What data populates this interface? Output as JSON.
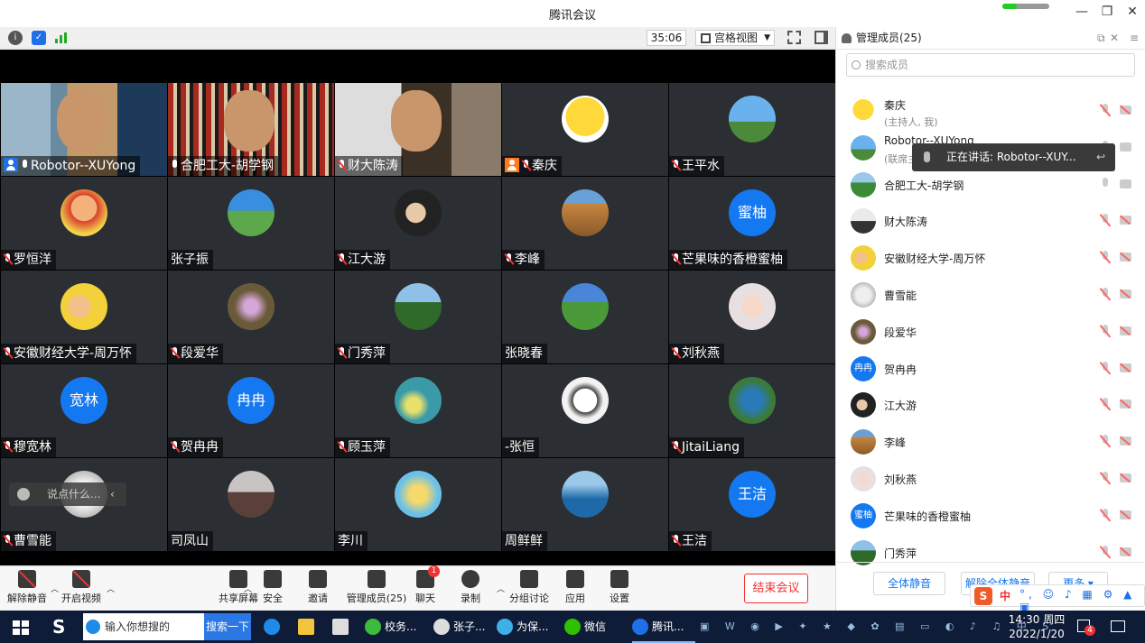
{
  "window": {
    "title": "腾讯会议"
  },
  "toolbar": {
    "timer": "35:06",
    "view_label": "宫格视图"
  },
  "tiles": [
    {
      "name": "Robotor--XUYong",
      "mic": "on",
      "badge": "blue",
      "video": "room"
    },
    {
      "name": "合肥工大-胡学钢",
      "mic": "on",
      "video": "curtain"
    },
    {
      "name": "财大陈涛",
      "mic": "off",
      "video": "light"
    },
    {
      "name": "秦庆",
      "mic": "off",
      "badge": "orange",
      "avatar": "duck"
    },
    {
      "name": "王平水",
      "mic": "off",
      "avatar": "sky"
    },
    {
      "name": "罗恒洋",
      "mic": "off",
      "avatar": "cartoon"
    },
    {
      "name": "张子振",
      "avatar": "field"
    },
    {
      "name": "江大游",
      "mic": "off",
      "avatar": "child"
    },
    {
      "name": "李峰",
      "mic": "off",
      "avatar": "colosseum"
    },
    {
      "name": "芒果味的香橙蜜柚",
      "mic": "off",
      "avatar_text": "蜜柚"
    },
    {
      "name": "安徽财经大学-周万怀",
      "mic": "off",
      "avatar": "baby"
    },
    {
      "name": "段爱华",
      "mic": "off",
      "avatar": "flower"
    },
    {
      "name": "门秀萍",
      "mic": "off",
      "avatar": "palm"
    },
    {
      "name": "张晓春",
      "avatar": "meadow"
    },
    {
      "name": "刘秋燕",
      "mic": "off",
      "avatar": "girl"
    },
    {
      "name": "穆宽林",
      "mic": "off",
      "avatar_text": "宽林"
    },
    {
      "name": "贺冉冉",
      "mic": "off",
      "avatar_text": "冉冉"
    },
    {
      "name": "顾玉萍",
      "mic": "off",
      "avatar": "dandelion"
    },
    {
      "name": "-张恒",
      "avatar": "drawn"
    },
    {
      "name": "JitaiLiang",
      "mic": "off",
      "avatar": "tree"
    },
    {
      "name": "曹雪能",
      "mic": "off",
      "avatar": "sketch"
    },
    {
      "name": "司凤山",
      "avatar": "pier"
    },
    {
      "name": "李川",
      "avatar": "anime"
    },
    {
      "name": "周鲜鲜",
      "avatar": "sea"
    },
    {
      "name": "王洁",
      "mic": "off",
      "avatar_text": "王洁"
    }
  ],
  "chat_hint": "说点什么...",
  "bottombar": {
    "items": [
      {
        "label": "解除静音",
        "icon": "mic-off-icon"
      },
      {
        "label": "开启视频",
        "icon": "camera-off-icon"
      },
      {
        "label": "共享屏幕",
        "icon": "share-screen-icon"
      },
      {
        "label": "安全",
        "icon": "shield-icon"
      },
      {
        "label": "邀请",
        "icon": "invite-icon"
      },
      {
        "label": "管理成员(25)",
        "icon": "members-icon"
      },
      {
        "label": "聊天",
        "icon": "chat-icon",
        "badge": "1"
      },
      {
        "label": "录制",
        "icon": "record-icon"
      },
      {
        "label": "分组讨论",
        "icon": "breakout-icon"
      },
      {
        "label": "应用",
        "icon": "apps-icon"
      },
      {
        "label": "设置",
        "icon": "gear-icon"
      }
    ],
    "end_label": "结束会议"
  },
  "panel": {
    "title": "管理成员(25)",
    "search_placeholder": "搜索成员",
    "members": [
      {
        "name": "秦庆",
        "sub": "(主持人, 我)",
        "avatar": "duck",
        "mic": "off"
      },
      {
        "name": "Robotor--XUYong",
        "sub": "(联席主",
        "avatar": "sky",
        "mic": "on"
      },
      {
        "name": "合肥工大-胡学钢",
        "avatar": "golf",
        "mic": "on"
      },
      {
        "name": "财大陈涛",
        "avatar": "silhouette",
        "mic": "off"
      },
      {
        "name": "安徽财经大学-周万怀",
        "avatar": "baby",
        "mic": "off"
      },
      {
        "name": "曹雪能",
        "avatar": "sketch",
        "mic": "off"
      },
      {
        "name": "段爱华",
        "avatar": "flower",
        "mic": "off"
      },
      {
        "name": "贺冉冉",
        "avatar_text": "冉冉",
        "mic": "off"
      },
      {
        "name": "江大游",
        "avatar": "child",
        "mic": "off"
      },
      {
        "name": "李峰",
        "avatar": "colosseum",
        "mic": "off"
      },
      {
        "name": "刘秋燕",
        "avatar": "girl",
        "mic": "off"
      },
      {
        "name": "芒果味的香橙蜜柚",
        "avatar_text": "蜜柚",
        "mic": "off"
      },
      {
        "name": "门秀萍",
        "avatar": "palm",
        "mic": "off"
      }
    ],
    "speaking": "正在讲话: Robotor--XUY...",
    "footer": {
      "mute_all": "全体静音",
      "unmute_all": "解除全体静音",
      "more": "更多 ▾"
    }
  },
  "taskbar": {
    "search_placeholder": "输入你想搜的",
    "search_button": "搜索一下",
    "apps": [
      {
        "label": "校务...",
        "color": "#3dbb3d"
      },
      {
        "label": "张子...",
        "color": "#ddd"
      },
      {
        "label": "为保...",
        "color": "#3db0e8"
      },
      {
        "label": "微信",
        "color": "#2dc100"
      },
      {
        "label": "腾讯...",
        "color": "#1e6fe8"
      }
    ],
    "time": "14:30 周四",
    "date": "2022/1/20",
    "notify_count": "4",
    "ime_lang": "中"
  }
}
